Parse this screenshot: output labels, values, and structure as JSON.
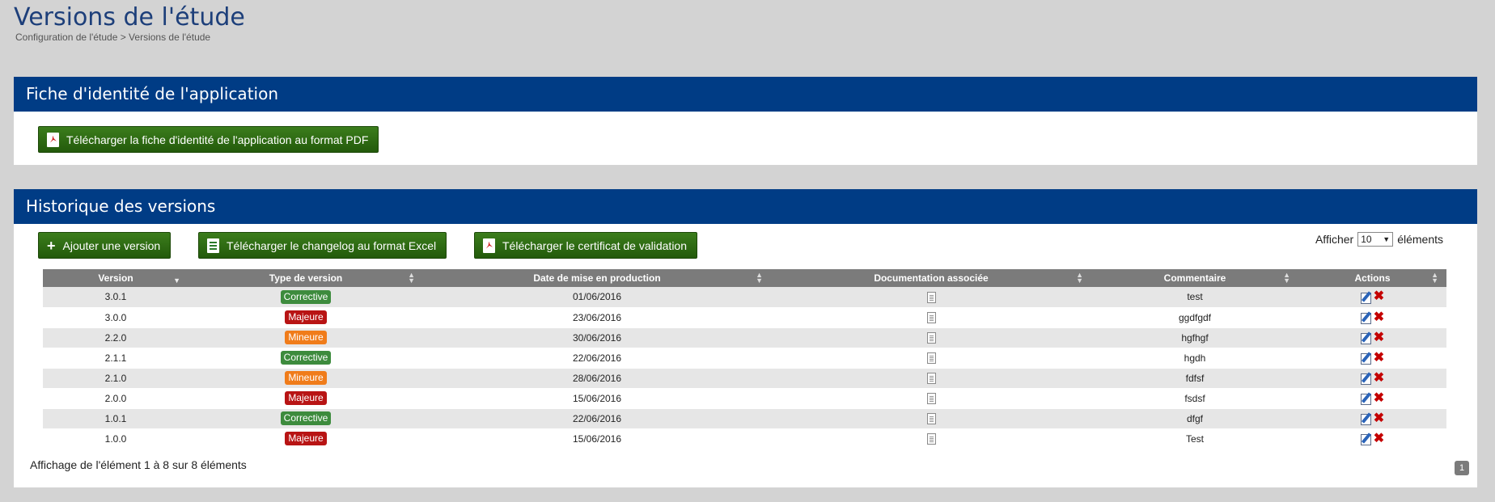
{
  "header": {
    "title": "Versions de l'étude",
    "breadcrumb": "Configuration de l'étude > Versions de l'étude"
  },
  "identity_panel": {
    "title": "Fiche d'identité de l'application",
    "download_button": "Télécharger la fiche d'identité de l'application au format PDF"
  },
  "history_panel": {
    "title": "Historique des versions",
    "buttons": {
      "add": "Ajouter une version",
      "changelog": "Télécharger le changelog au format Excel",
      "certificate": "Télécharger le certificat de validation"
    },
    "page_size": {
      "label_before": "Afficher",
      "value": "10",
      "label_after": "éléments"
    },
    "columns": [
      "Version",
      "Type de version",
      "Date de mise en production",
      "Documentation associée",
      "Commentaire",
      "Actions"
    ],
    "rows": [
      {
        "version": "3.0.1",
        "type": "Corrective",
        "date": "01/06/2016",
        "comment": "test"
      },
      {
        "version": "3.0.0",
        "type": "Majeure",
        "date": "23/06/2016",
        "comment": "ggdfgdf"
      },
      {
        "version": "2.2.0",
        "type": "Mineure",
        "date": "30/06/2016",
        "comment": "hgfhgf"
      },
      {
        "version": "2.1.1",
        "type": "Corrective",
        "date": "22/06/2016",
        "comment": "hgdh"
      },
      {
        "version": "2.1.0",
        "type": "Mineure",
        "date": "28/06/2016",
        "comment": "fdfsf"
      },
      {
        "version": "2.0.0",
        "type": "Majeure",
        "date": "15/06/2016",
        "comment": "fsdsf"
      },
      {
        "version": "1.0.1",
        "type": "Corrective",
        "date": "22/06/2016",
        "comment": "dfgf"
      },
      {
        "version": "1.0.0",
        "type": "Majeure",
        "date": "15/06/2016",
        "comment": "Test"
      }
    ],
    "info": "Affichage de l'élément 1 à 8 sur 8 éléments",
    "current_page": "1"
  },
  "colors": {
    "header_blue": "#003c85",
    "button_green": "#2e6b12",
    "badge_corrective": "#3d8b3d",
    "badge_majeure": "#b81414",
    "badge_mineure": "#f07c1a",
    "table_header": "#7b7b7b"
  },
  "icons": {
    "pdf": "pdf-icon",
    "excel": "excel-icon",
    "add": "plus-icon",
    "document": "document-icon",
    "edit": "edit-icon",
    "delete": "delete-icon"
  }
}
